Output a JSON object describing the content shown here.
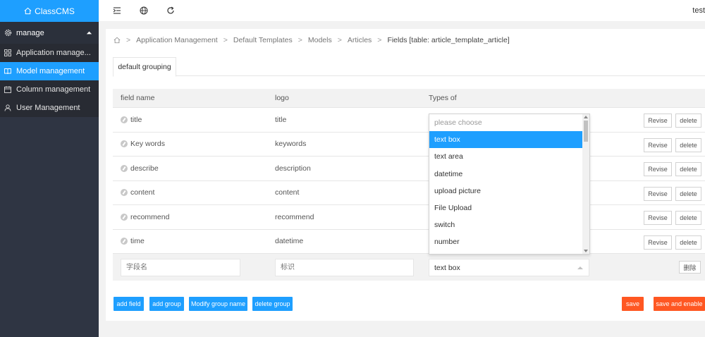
{
  "app": {
    "name": "ClassCMS"
  },
  "sidebar": {
    "group": {
      "label": "manage"
    },
    "items": [
      {
        "label": "Application manage...",
        "icon": "apps-icon"
      },
      {
        "label": "Model management",
        "icon": "book-icon",
        "active": true
      },
      {
        "label": "Column management",
        "icon": "calendar-icon"
      },
      {
        "label": "User Management",
        "icon": "user-icon"
      }
    ]
  },
  "header": {
    "user": "test"
  },
  "breadcrumb": {
    "items": [
      "Application Management",
      "Default Templates",
      "Models",
      "Articles"
    ],
    "current": "Fields [table: article_template_article]"
  },
  "tabs": [
    {
      "label": "default grouping"
    }
  ],
  "table": {
    "headers": [
      "field name",
      "logo",
      "Types of"
    ],
    "rows": [
      {
        "name": "title",
        "logo": "title"
      },
      {
        "name": "Key words",
        "logo": "keywords"
      },
      {
        "name": "describe",
        "logo": "description"
      },
      {
        "name": "content",
        "logo": "content"
      },
      {
        "name": "recommend",
        "logo": "recommend"
      },
      {
        "name": "time",
        "logo": "datetime"
      }
    ],
    "row_actions": {
      "revise": "Revise",
      "delete": "delete"
    },
    "new_row": {
      "name_placeholder": "字段名",
      "logo_placeholder": "标识",
      "type_value": "text box",
      "delete_label": "删除"
    }
  },
  "dropdown": {
    "placeholder": "please choose",
    "options": [
      "text box",
      "text area",
      "datetime",
      "upload picture",
      "File Upload",
      "switch",
      "number"
    ],
    "selected": "text box"
  },
  "buttons": {
    "add_field": "add field",
    "add_group": "add group",
    "modify_group": "Modify group name",
    "delete_group": "delete group",
    "save": "save",
    "save_enable": "save and enable"
  },
  "colors": {
    "primary": "#1e9fff",
    "danger": "#ff5722",
    "sidebar": "#2f3543"
  }
}
